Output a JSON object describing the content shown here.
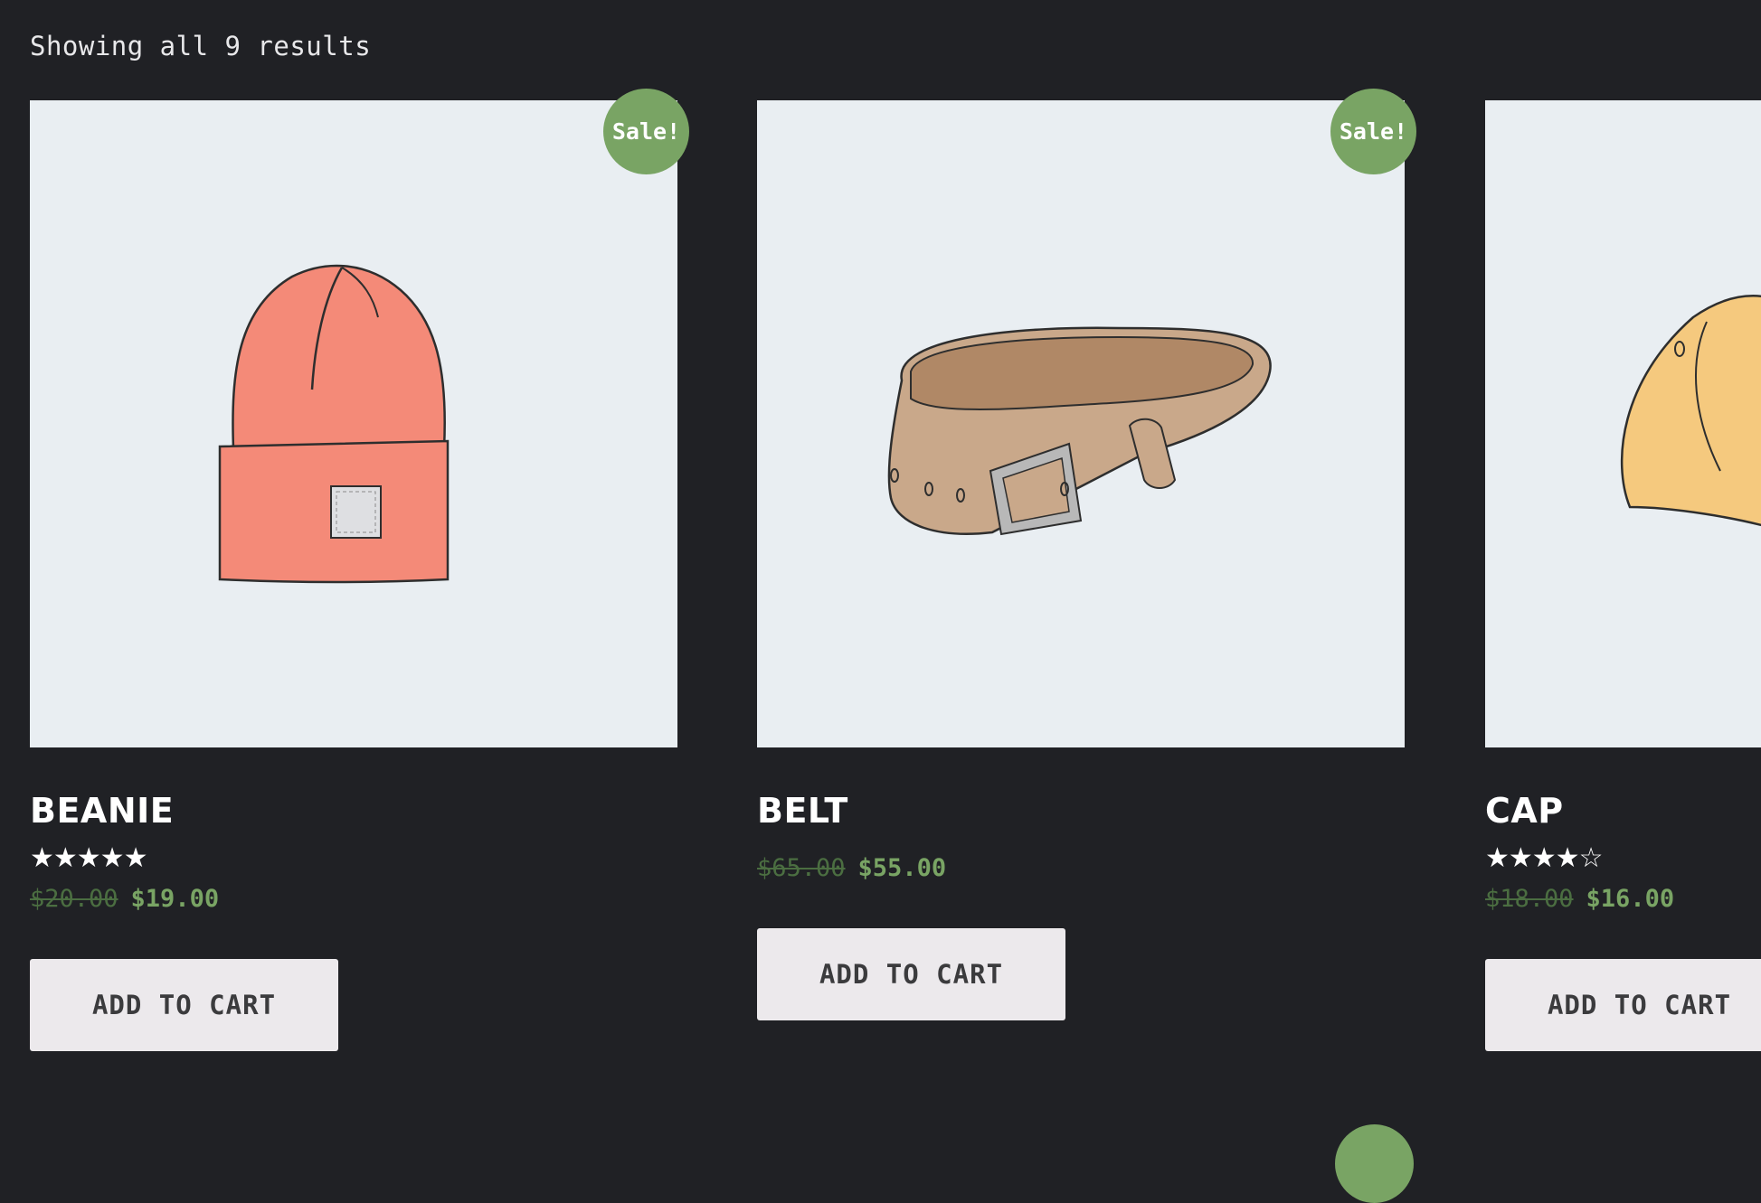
{
  "result_count": "Showing all 9 results",
  "colors": {
    "background": "#202125",
    "sale_badge": "#79a464",
    "price_new": "#79a464",
    "price_old": "#4b6e41",
    "button_bg": "#ece9ec"
  },
  "products": [
    {
      "title": "BEANIE",
      "image_icon": "beanie-image",
      "sale_badge": "Sale!",
      "rating": 5,
      "rating_stars": "★★★★★",
      "old_price": "$20.00",
      "new_price": "$19.00",
      "button": "ADD TO CART"
    },
    {
      "title": "BELT",
      "image_icon": "belt-image",
      "sale_badge": "Sale!",
      "old_price": "$65.00",
      "new_price": "$55.00",
      "button": "ADD TO CART"
    },
    {
      "title": "CAP",
      "image_icon": "cap-image",
      "rating": 4,
      "rating_stars": "★★★★☆",
      "old_price": "$18.00",
      "new_price": "$16.00",
      "button": "ADD TO CART"
    }
  ]
}
